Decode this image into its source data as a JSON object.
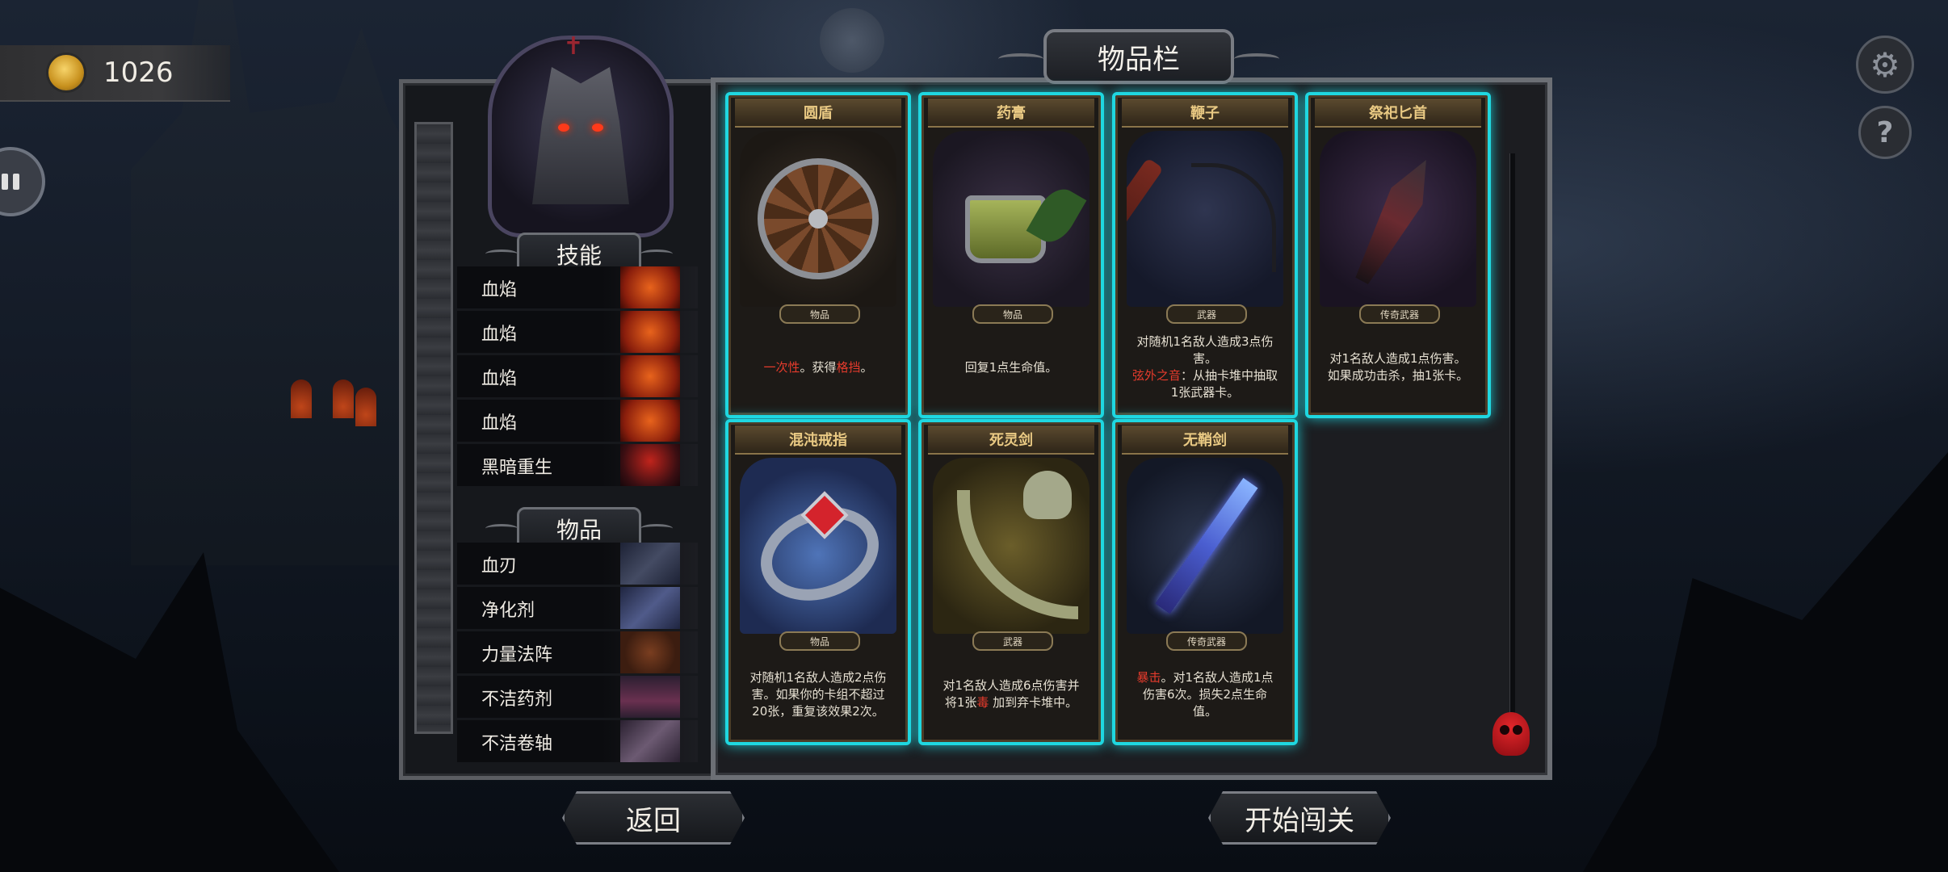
{
  "currency": {
    "amount": "1026",
    "icon": "gold-coin-icon"
  },
  "item_bar_title": "物品栏",
  "skills": {
    "header": "技能",
    "items": [
      {
        "label": "血焰",
        "icon": "fire-skill-icon"
      },
      {
        "label": "血焰",
        "icon": "fire-skill-icon"
      },
      {
        "label": "血焰",
        "icon": "fire-skill-icon"
      },
      {
        "label": "血焰",
        "icon": "fire-skill-icon"
      },
      {
        "label": "黑暗重生",
        "icon": "dark-rebirth-icon"
      }
    ]
  },
  "items": {
    "header": "物品",
    "list": [
      {
        "label": "血刃",
        "icon": "blade-icon"
      },
      {
        "label": "净化剂",
        "icon": "potion-icon"
      },
      {
        "label": "力量法阵",
        "icon": "rune-circle-icon"
      },
      {
        "label": "不洁药剂",
        "icon": "bottle-icon"
      },
      {
        "label": "不洁卷轴",
        "icon": "scroll-icon"
      }
    ]
  },
  "cards": [
    {
      "title": "圆盾",
      "type": "物品",
      "desc_parts": [
        {
          "t": "一次性",
          "red": true
        },
        {
          "t": "。获得",
          "red": false
        },
        {
          "t": "格挡",
          "red": true
        },
        {
          "t": "。",
          "red": false
        }
      ]
    },
    {
      "title": "药膏",
      "type": "物品",
      "desc_parts": [
        {
          "t": "回复1点生命值。",
          "red": false
        }
      ]
    },
    {
      "title": "鞭子",
      "type": "武器",
      "desc_parts": [
        {
          "t": "对随机1名敌人造成3点伤害。\n",
          "red": false
        },
        {
          "t": "弦外之音",
          "red": true
        },
        {
          "t": "：从抽卡堆中抽取1张武器卡。",
          "red": false
        }
      ]
    },
    {
      "title": "祭祀匕首",
      "type": "传奇武器",
      "desc_parts": [
        {
          "t": "对1名敌人造成1点伤害。如果成功击杀，抽1张卡。",
          "red": false
        }
      ]
    },
    {
      "title": "混沌戒指",
      "type": "物品",
      "desc_parts": [
        {
          "t": "对随机1名敌人造成2点伤害。如果你的卡组不超过20张，重复该效果2次。",
          "red": false
        }
      ]
    },
    {
      "title": "死灵剑",
      "type": "武器",
      "desc_parts": [
        {
          "t": "对1名敌人造成6点伤害并将1张",
          "red": false
        },
        {
          "t": "毒",
          "red": true
        },
        {
          "t": " 加到弃卡堆中。",
          "red": false
        }
      ]
    },
    {
      "title": "无鞘剑",
      "type": "传奇武器",
      "desc_parts": [
        {
          "t": "暴击",
          "red": true
        },
        {
          "t": "。对1名敌人造成1点伤害6次。损失2点生命值。",
          "red": false
        }
      ]
    }
  ],
  "buttons": {
    "back": "返回",
    "start": "开始闯关"
  },
  "colors": {
    "card_glow": "#1fd7e0",
    "accent_red": "#e53b2c",
    "card_title": "#e9c983"
  }
}
